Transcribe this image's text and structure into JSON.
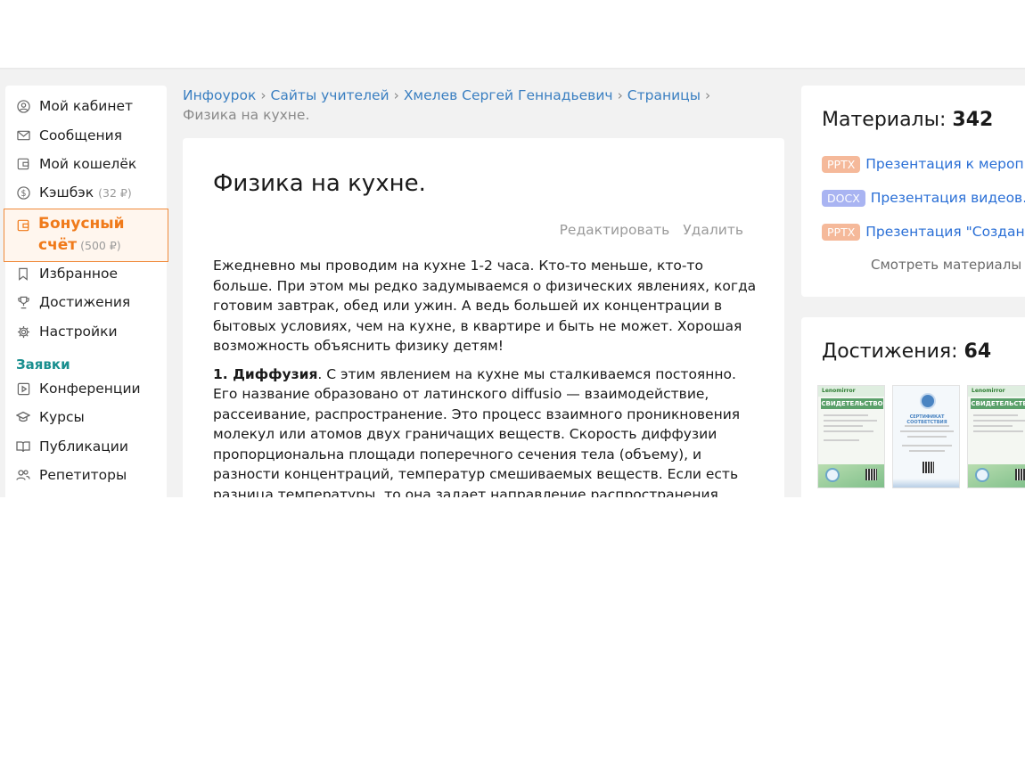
{
  "sidebar": {
    "items": [
      {
        "label": "Мой кабинет",
        "icon": "user-circle-icon"
      },
      {
        "label": "Сообщения",
        "icon": "envelope-icon"
      },
      {
        "label": "Мой кошелёк",
        "icon": "wallet-icon"
      },
      {
        "label": "Кэшбэк",
        "sub": "(32 ₽)",
        "icon": "dollar-circle-icon"
      },
      {
        "label": "Избранное",
        "icon": "bookmark-icon"
      },
      {
        "label": "Достижения",
        "icon": "trophy-icon"
      },
      {
        "label": "Настройки",
        "icon": "gear-icon"
      },
      {
        "label": "Конференции",
        "icon": "play-square-icon"
      },
      {
        "label": "Курсы",
        "icon": "graduation-cap-icon"
      },
      {
        "label": "Публикации",
        "icon": "book-open-icon"
      },
      {
        "label": "Репетиторы",
        "icon": "users-icon"
      }
    ],
    "active": {
      "line1": "Бонусный",
      "line2": "счёт",
      "sub": "(500 ₽)",
      "icon": "wallet-icon"
    },
    "section_title": "Заявки",
    "accent_color": "#f07a1a"
  },
  "breadcrumbs": {
    "items": [
      "Инфоурок",
      "Сайты учителей",
      "Хмелев Сергей Геннадьевич",
      "Страницы"
    ],
    "separator": "›",
    "current": "Физика на кухне."
  },
  "main": {
    "title": "Физика на кухне.",
    "edit_label": "Редактировать",
    "delete_label": "Удалить",
    "paragraph1": "Ежедневно мы проводим на кухне 1-2 часа. Кто-то меньше, кто-то больше. При этом мы редко задумываемся о физических явлениях, когда готовим завтрак, обед или ужин. А ведь большей их концентрации в бытовых условиях, чем на кухне, в квартире и быть не может. Хорошая возможность объяснить физику детям!",
    "paragraph2_heading": "1. Диффузия",
    "paragraph2": ". С этим явлением на кухне мы сталкиваемся постоянно. Его название образовано от латинского diffusio — взаимодействие, рассеивание, распространение. Это процесс взаимного проникновения молекул или атомов двух граничащих веществ. Скорость диффузии пропорциональна площади поперечного сечения тела (объему), и разности концентраций, температур смешиваемых веществ. Если есть разница температуры, то она задает направление распространения (градиент) — от горячего к холодному"
  },
  "materials": {
    "title": "Материалы:",
    "count": "342",
    "items": [
      {
        "badge": "PPTX",
        "badge_color": "#f5b99a",
        "title": "Презентация к мероп..."
      },
      {
        "badge": "DOCX",
        "badge_color": "#a9b4f2",
        "title": "Презентация видеов..."
      },
      {
        "badge": "PPTX",
        "badge_color": "#f5b99a",
        "title": "Презентация \"Создан..."
      }
    ],
    "more_label": "Смотреть материалы ›"
  },
  "achievements": {
    "title": "Достижения:",
    "count": "64",
    "certificates": [
      {
        "brand": "Lenomirror",
        "title": "СВИДЕТЕЛЬСТВО",
        "style": "green"
      },
      {
        "brand": "",
        "title": "СЕРТИФИКАТ СООТВЕТСТВИЯ",
        "style": "blue"
      },
      {
        "brand": "Lenomirror",
        "title": "СВИДЕТЕЛЬСТВО",
        "style": "green"
      }
    ]
  }
}
